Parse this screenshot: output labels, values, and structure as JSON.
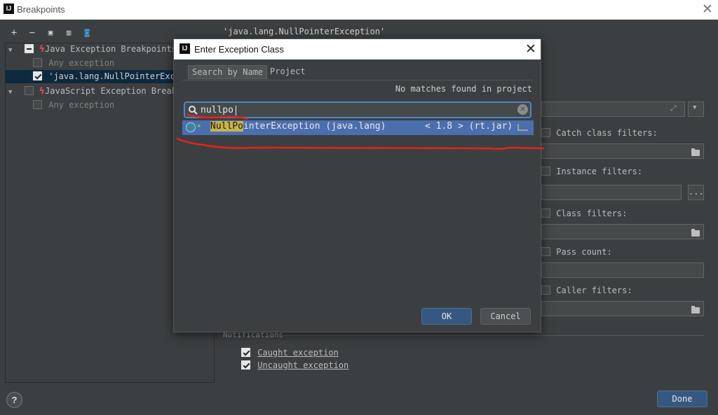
{
  "window": {
    "title": "Breakpoints",
    "logo": "IJ"
  },
  "toolbar": {
    "icons": [
      "add-icon",
      "remove-icon",
      "group-folder-icon",
      "group-class-icon",
      "view-breakpoint-icon"
    ]
  },
  "tree": {
    "java_group": "Java Exception Breakpoints",
    "java_any": "Any exception",
    "java_npe": "'java.lang.NullPointerExce",
    "js_group": "JavaScript Exception Breakp",
    "js_any": "Any exception"
  },
  "detail": {
    "header": "'java.lang.NullPointerException'",
    "catch_label": "Catch class filters:",
    "instance_label": "Instance filters:",
    "class_label": "Class filters:",
    "pass_label": "Pass count:",
    "caller_label": "Caller filters:",
    "notifications": "Notifications",
    "caught": "Caught exception",
    "uncaught": "Uncaught exception",
    "ellipsis": "..."
  },
  "footer": {
    "help": "?",
    "done": "Done"
  },
  "dialog": {
    "logo": "IJ",
    "title": "Enter Exception Class",
    "tab_name": "Search by Name",
    "tab_project": "Project",
    "status": "No matches found in project",
    "query": "nullpo",
    "result": {
      "match": "NullPo",
      "rest": "interException (java.lang)",
      "version": "< 1.8 > (rt.jar)"
    },
    "ok": "OK",
    "cancel": "Cancel"
  },
  "colors": {
    "accent": "#4b6eaf",
    "highlight": "#c9b24a",
    "annotation": "#e8201c",
    "done_button": "#365880"
  }
}
